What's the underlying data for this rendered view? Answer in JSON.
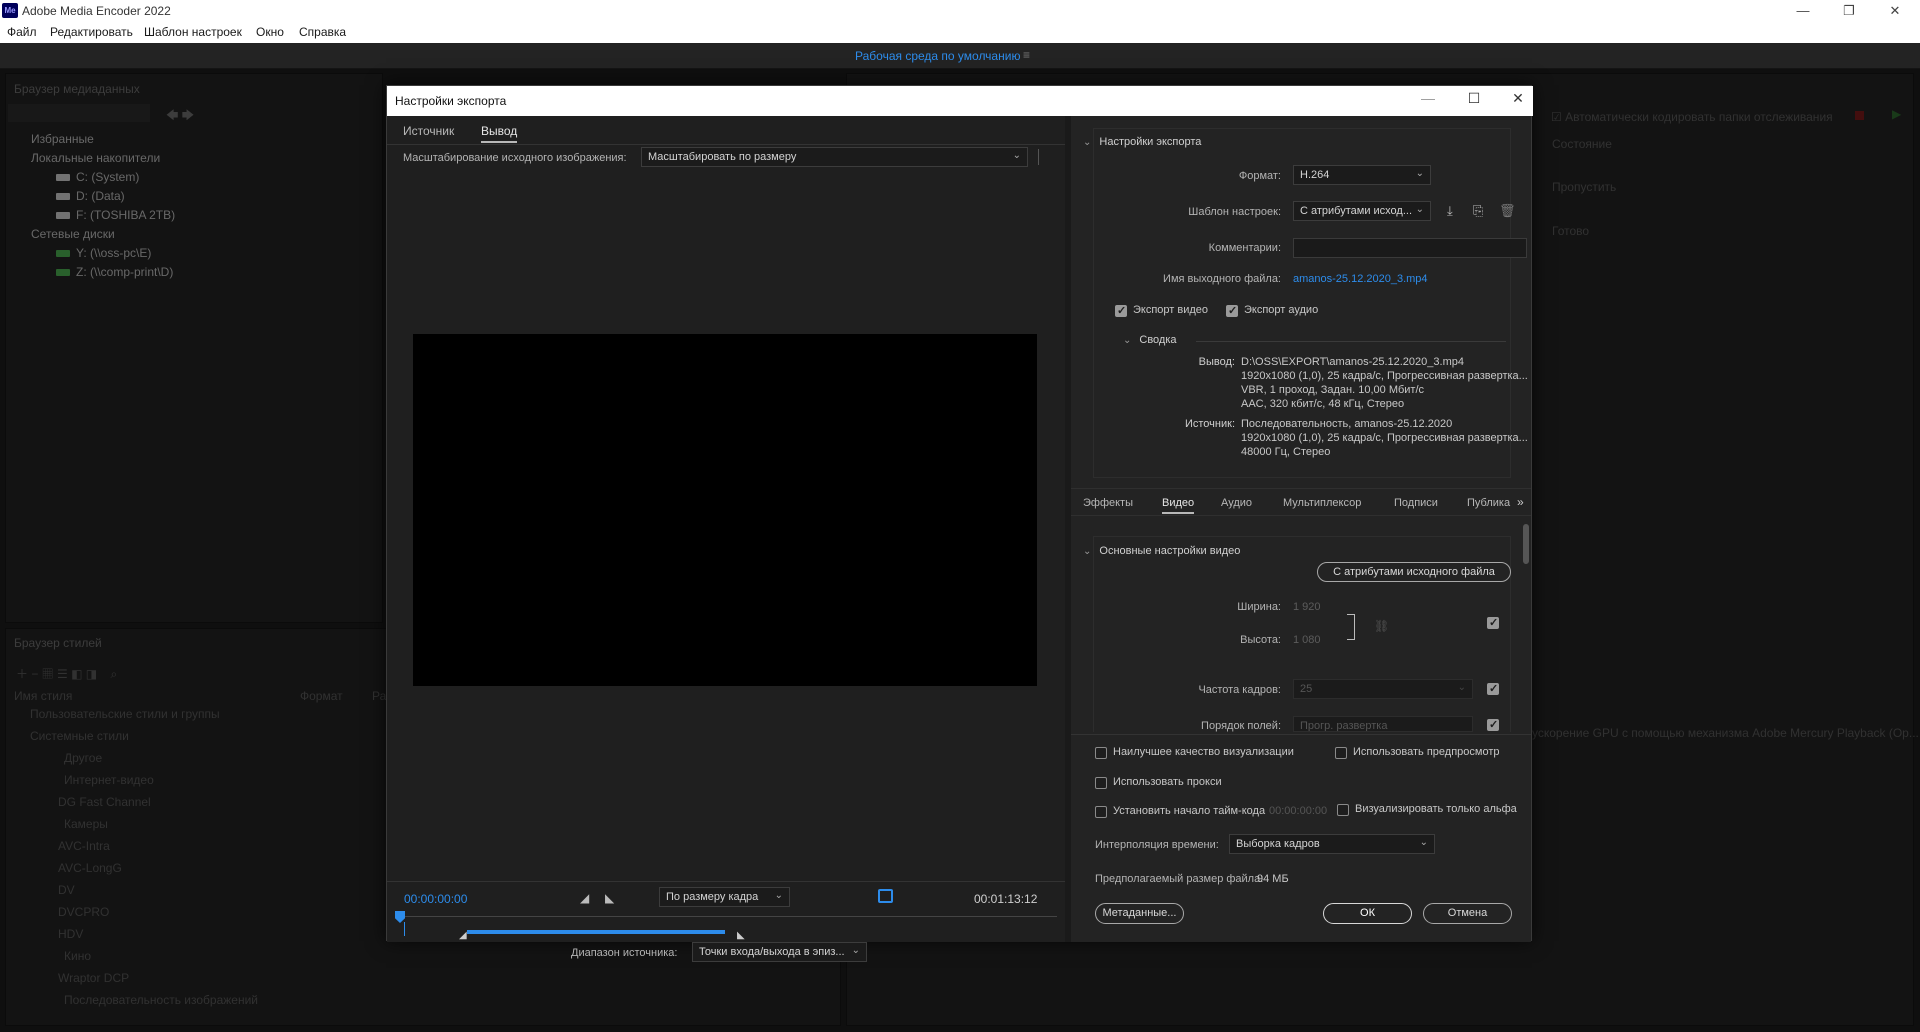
{
  "app": {
    "title": "Adobe Media Encoder 2022",
    "icon_text": "Me",
    "menu": [
      "Файл",
      "Редактировать",
      "Шаблон настроек",
      "Окно",
      "Справка"
    ],
    "workspace": "Рабочая среда по умолчанию"
  },
  "background": {
    "media_browser": {
      "title": "Браузер медиаданных",
      "favorites": "Избранные",
      "local_drives": "Локальные накопители",
      "drives": [
        "C: (System)",
        "D: (Data)",
        "F: (TOSHIBA 2TB)"
      ],
      "network_drives": "Сетевые диски",
      "net": [
        "Y: (\\\\oss-pc\\E)",
        "Z: (\\\\comp-print\\D)"
      ]
    },
    "styles_browser": {
      "title": "Браузер стилей",
      "col_name": "Имя стиля",
      "col_format": "Формат",
      "col_extra": "Ра",
      "rows": [
        "Пользовательские стили и группы",
        "Системные стили",
        "Другое",
        "Интернет-видео",
        "DG Fast Channel",
        "Камеры",
        "AVC-Intra",
        "AVC-LongG",
        "DV",
        "DVCPRO",
        "HDV",
        "Кино",
        "Wraptor DCP",
        "Последовательность изображений"
      ]
    },
    "queue": {
      "auto_encode": "Автоматически кодировать папки отслеживания",
      "col_state": "Состояние",
      "skip": "Пропустить",
      "done": "Готово",
      "gpu_status": "ускорение GPU с помощью механизма Adobe Mercury Playback (Op..."
    }
  },
  "dialog": {
    "title": "Настройки экспорта",
    "left_tabs": [
      "Источник",
      "Вывод"
    ],
    "scale_label": "Масштабирование исходного изображения:",
    "scale_value": "Масштабировать по размеру",
    "timecode_start": "00:00:00:00",
    "timecode_end": "00:01:13:12",
    "fit_value": "По размеру кадра",
    "source_range_label": "Диапазон источника:",
    "source_range_value": "Точки входа/выхода в эпиз...",
    "export_settings": {
      "header": "Настройки экспорта",
      "format_label": "Формат:",
      "format_value": "H.264",
      "preset_label": "Шаблон настроек:",
      "preset_value": "С атрибутами исход...",
      "comment_label": "Комментарии:",
      "comment_value": "",
      "output_name_label": "Имя выходного файла:",
      "output_name_value": "amanos-25.12.2020_3.mp4",
      "export_video": "Экспорт видео",
      "export_audio": "Экспорт аудио",
      "summary_header": "Сводка",
      "output_label": "Вывод:",
      "output_lines": [
        "D:\\OSS\\EXPORT\\amanos-25.12.2020_3.mp4",
        "1920x1080 (1,0), 25 кадра/с, Прогрессивная развертка...",
        "VBR, 1 проход, Задан. 10,00 Мбит/с",
        "AAC, 320 кбит/с, 48 кГц, Стерео"
      ],
      "source_label": "Источник:",
      "source_lines": [
        "Последовательность, amanos-25.12.2020",
        "1920x1080 (1,0), 25 кадра/с, Прогрессивная развертка...",
        "48000 Гц, Стерео"
      ]
    },
    "right_tabs": [
      "Эффекты",
      "Видео",
      "Аудио",
      "Мультиплексор",
      "Подписи",
      "Публика"
    ],
    "video": {
      "header": "Основные настройки видео",
      "match_source": "С атрибутами исходного файла",
      "width_label": "Ширина:",
      "width_value": "1 920",
      "height_label": "Высота:",
      "height_value": "1 080",
      "fps_label": "Частота кадров:",
      "fps_value": "25",
      "field_order_label": "Порядок полей:",
      "field_order_value": "Прогр. развертка"
    },
    "bottom": {
      "max_render": "Наилучшее качество визуализации",
      "use_previews": "Использовать предпросмотр",
      "use_proxies": "Использовать прокси",
      "set_start_tc": "Установить начало тайм-кода",
      "start_tc_value": "00:00:00:00",
      "render_alpha": "Визуализировать только альфа",
      "interp_label": "Интерполяция времени:",
      "interp_value": "Выборка кадров",
      "est_size_label": "Предполагаемый размер файла:",
      "est_size_value": "94 МБ",
      "metadata_btn": "Метаданные...",
      "ok_btn": "ОК",
      "cancel_btn": "Отмена"
    }
  }
}
